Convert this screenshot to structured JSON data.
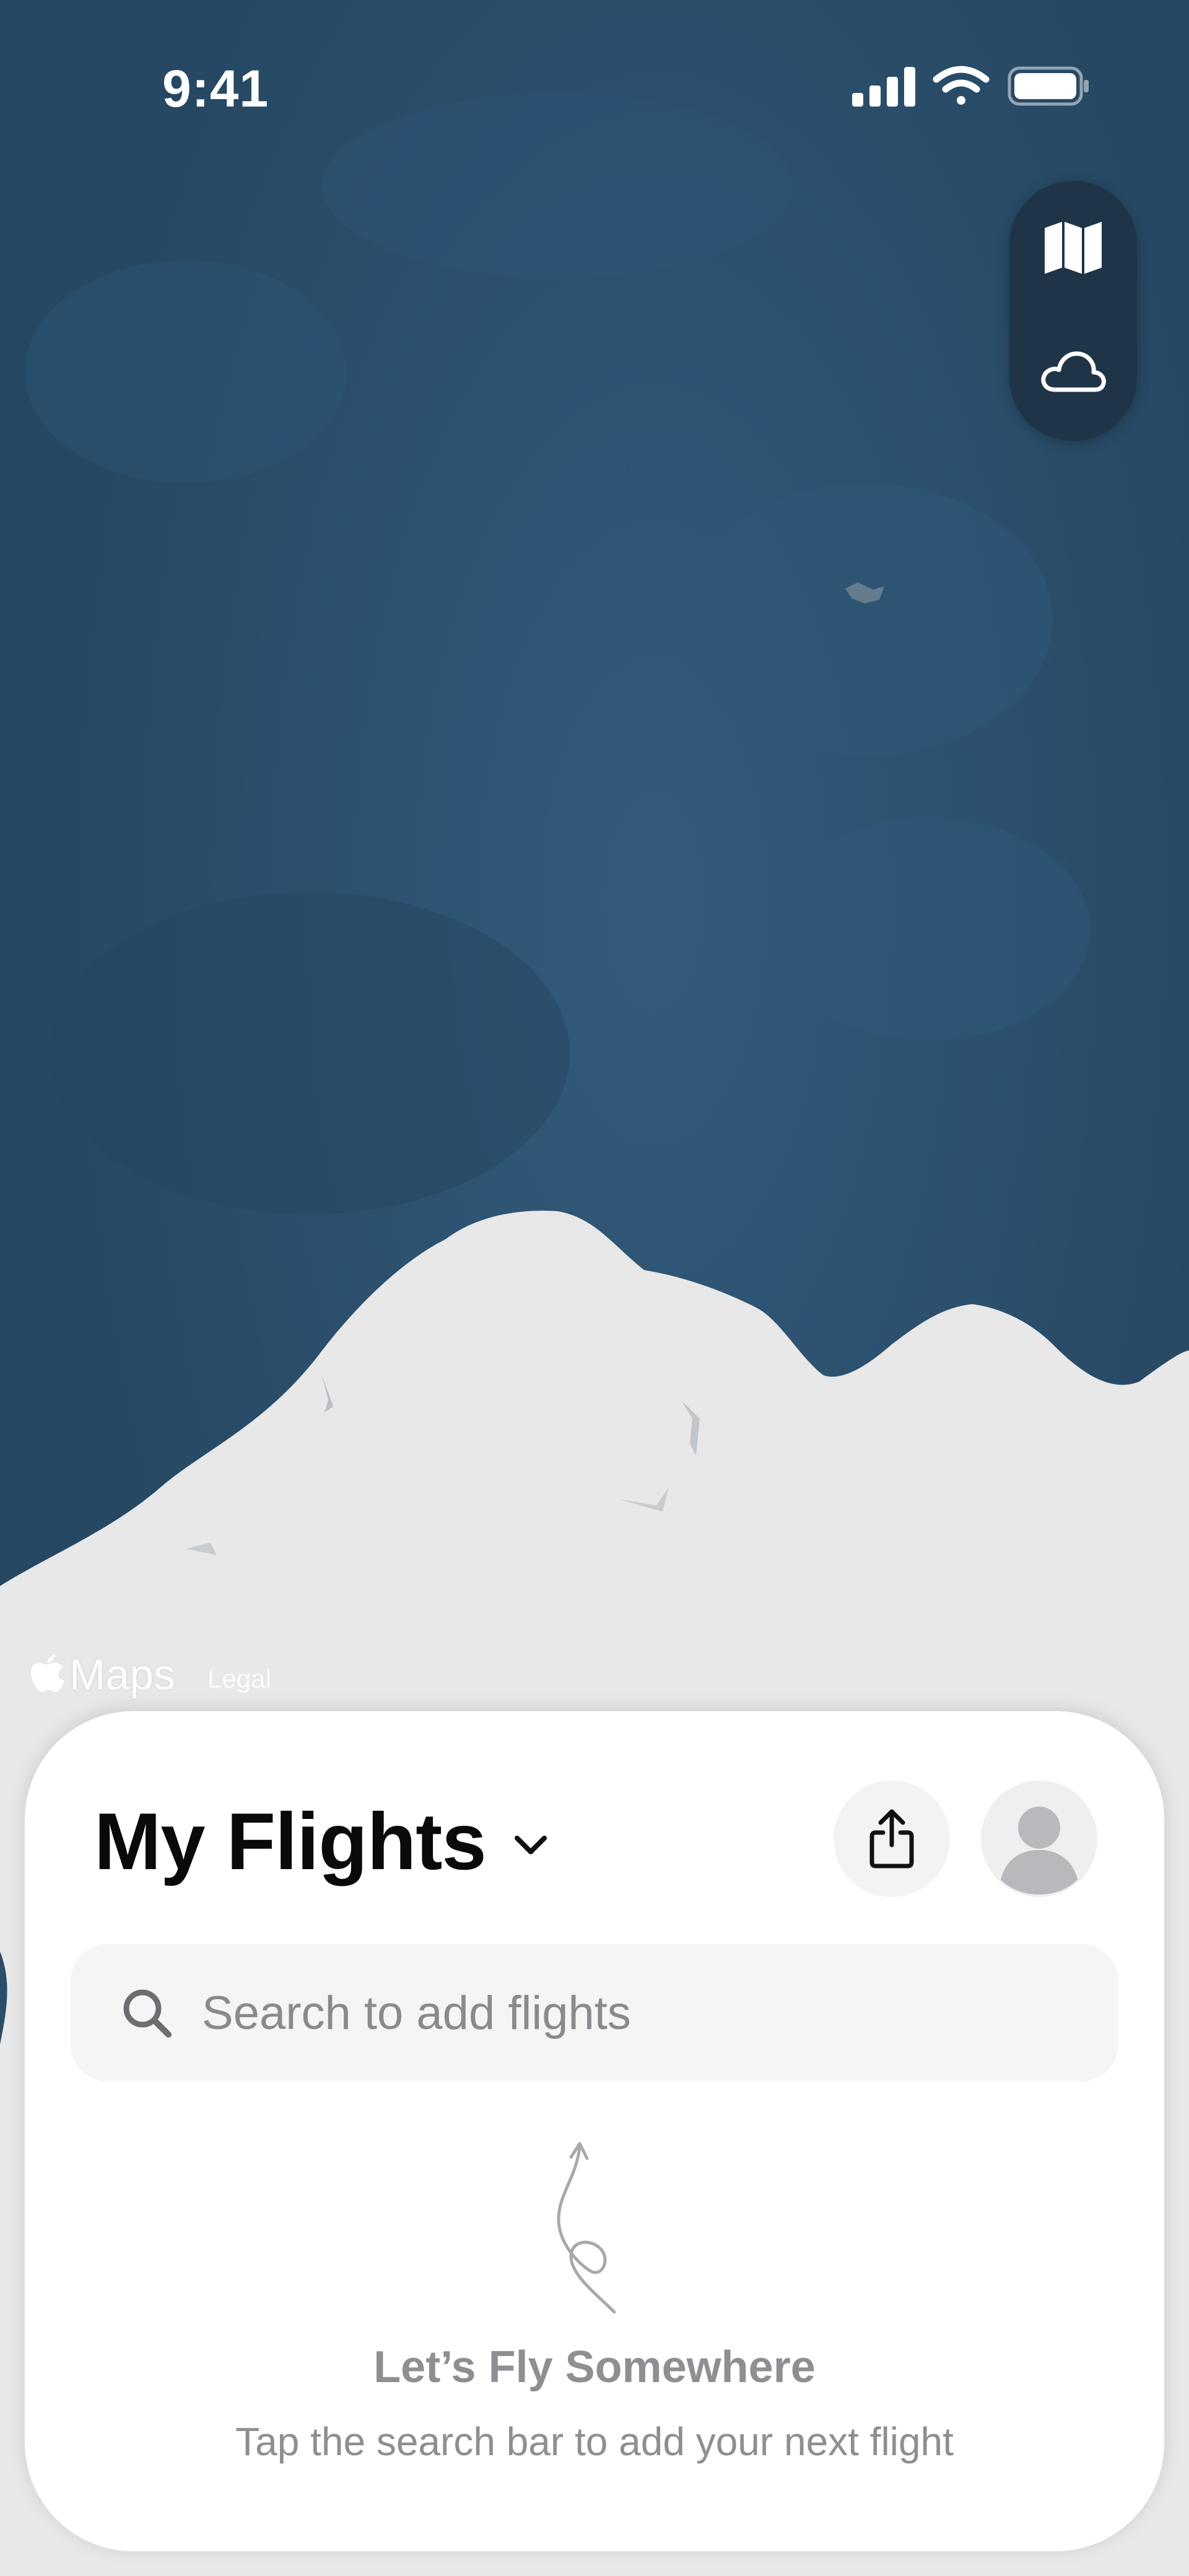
{
  "status_bar": {
    "time": "9:41",
    "icons": [
      "cellular-signal-icon",
      "wifi-icon",
      "battery-icon"
    ]
  },
  "map_controls": {
    "buttons": [
      {
        "icon": "map-icon"
      },
      {
        "icon": "cloud-icon"
      }
    ]
  },
  "map_attribution": {
    "logo": "Maps",
    "legal": "Legal"
  },
  "sheet": {
    "title": "My Flights",
    "title_menu_icon": "chevron-down-icon",
    "share_icon": "share-icon",
    "profile_icon": "person-icon",
    "search": {
      "placeholder": "Search to add flights",
      "icon": "search-icon"
    },
    "empty_state": {
      "illustration": "flight-path-arrow-icon",
      "title": "Let’s Fly Somewhere",
      "subtitle": "Tap the search bar to add your next flight"
    }
  },
  "colors": {
    "ocean": "#2a4d69",
    "land": "#e8e8e8",
    "control_bg": "#1f3447",
    "sheet_bg": "#ffffff",
    "muted_text": "#8e8e93"
  }
}
